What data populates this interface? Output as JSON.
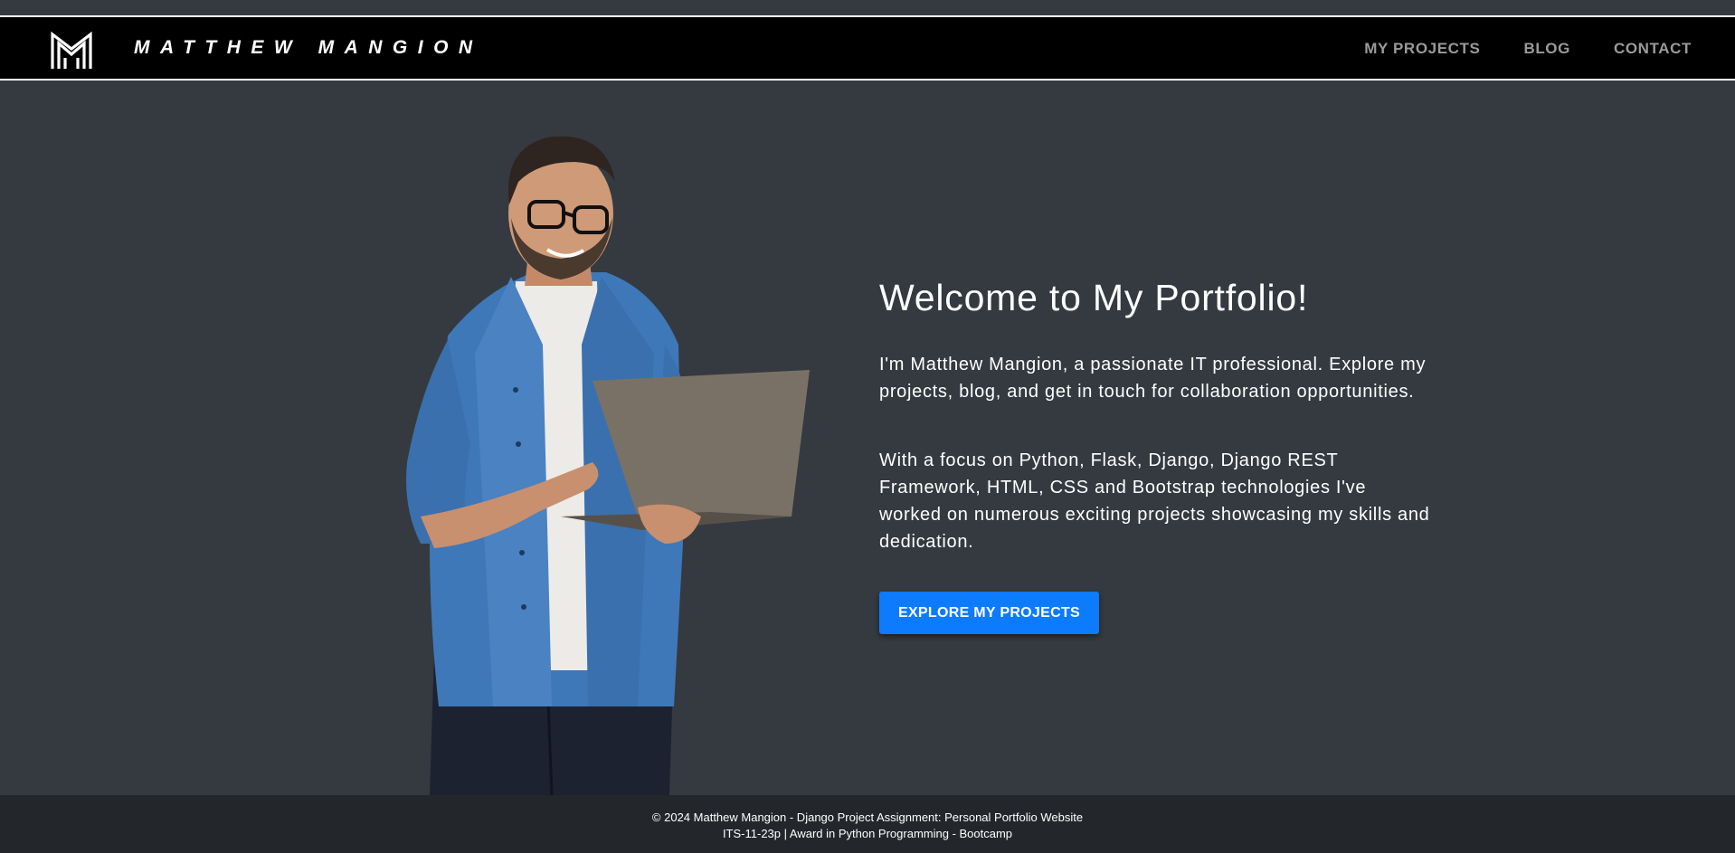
{
  "header": {
    "brand": "MATTHEW MANGION",
    "logo_icon": "mm-monogram-logo-icon",
    "nav": [
      {
        "label": "MY PROJECTS"
      },
      {
        "label": "BLOG"
      },
      {
        "label": "CONTACT"
      }
    ]
  },
  "hero": {
    "title": "Welcome to My Portfolio!",
    "paragraph1": "I'm Matthew Mangion, a passionate IT professional. Explore my projects, blog, and get in touch for collaboration opportunities.",
    "paragraph2": "With a focus on Python, Flask, Django, Django REST Framework, HTML, CSS and Bootstrap technologies I've worked on numerous exciting projects showcasing my skills and dedication.",
    "cta_label": "EXPLORE MY PROJECTS",
    "image": "man-with-laptop-photo"
  },
  "footer": {
    "line1": "© 2024 Matthew Mangion - Django Project Assignment: Personal Portfolio Website",
    "line2": "ITS-11-23p | Award in Python Programming - Bootcamp"
  },
  "colors": {
    "background": "#343a40",
    "navbar": "#000000",
    "accent": "#0d7bfd",
    "footer": "#23272b",
    "nav_link": "#9a9a9a"
  }
}
